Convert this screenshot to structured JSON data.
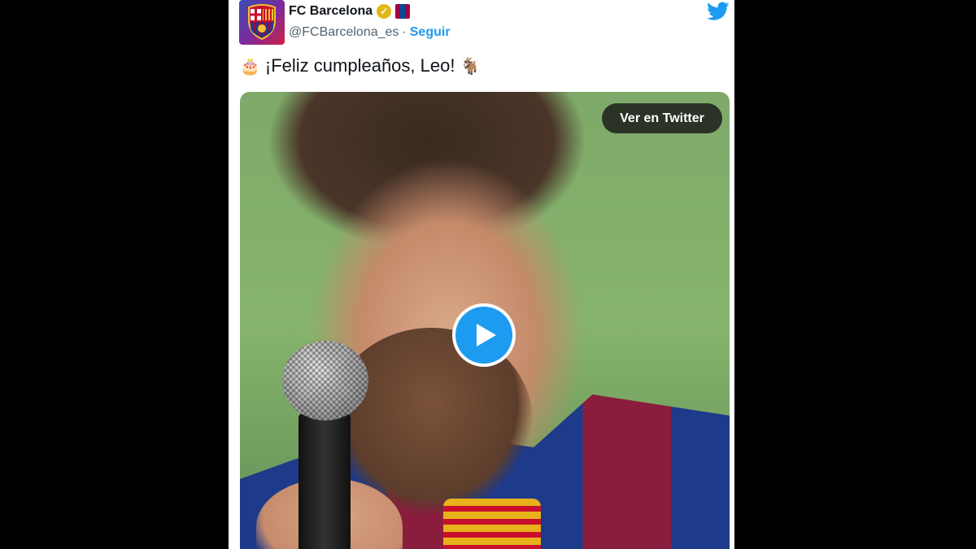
{
  "account": {
    "name": "FC Barcelona",
    "handle": "@FCBarcelona_es",
    "separator": "·",
    "follow_label": "Seguir"
  },
  "tweet": {
    "text": "¡Feliz cumpleaños, Leo!",
    "emoji_before": "🎂",
    "emoji_after": "🐐"
  },
  "media": {
    "view_button_label": "Ver en Twitter"
  },
  "icons": {
    "bird": "twitter-bird-icon",
    "verified": "verified-badge-icon",
    "play": "play-icon"
  },
  "colors": {
    "accent": "#1d9bf0",
    "verified": "#e2b719",
    "view_button_bg": "#2b3327"
  }
}
